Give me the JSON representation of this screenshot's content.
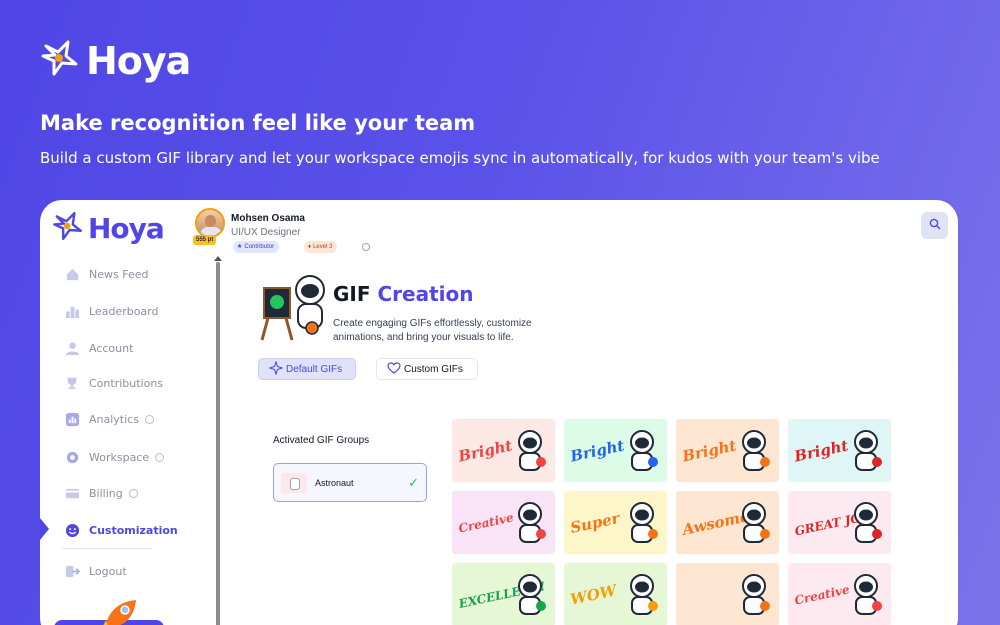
{
  "hero": {
    "brand": "Hoya",
    "title": "Make recognition feel like your team",
    "subtitle": "Build a custom GIF library and let your workspace emojis sync in automatically, for kudos with your team's vibe"
  },
  "app": {
    "brand": "Hoya",
    "sidebar": {
      "items": [
        {
          "label": "News Feed",
          "icon": "home-icon"
        },
        {
          "label": "Leaderboard",
          "icon": "leaderboard-icon"
        },
        {
          "label": "Account",
          "icon": "user-icon"
        },
        {
          "label": "Contributions",
          "icon": "trophy-icon"
        },
        {
          "label": "Analytics",
          "icon": "analytics-icon"
        },
        {
          "label": "Workspace",
          "icon": "gear-icon"
        },
        {
          "label": "Billing",
          "icon": "card-icon"
        },
        {
          "label": "Customization",
          "icon": "smile-icon"
        },
        {
          "label": "Logout",
          "icon": "logout-icon"
        }
      ]
    },
    "user": {
      "name": "Mohsen Osama",
      "role": "UI/UX Designer",
      "points": "555 pt",
      "badge_contributor": "Contributor",
      "badge_level": "Level 3"
    },
    "page": {
      "title_plain": "GIF",
      "title_accent": "Creation",
      "description": "Create engaging GIFs effortlessly, customize animations, and bring your visuals to life.",
      "tab_default": "Default GIFs",
      "tab_custom": "Custom GIFs",
      "groups_title": "Activated GIF Groups",
      "group_name": "Astronaut"
    },
    "gifs": [
      {
        "word": "Bright",
        "bg": "#fce8e4",
        "color": "#ef4444"
      },
      {
        "word": "Bright",
        "bg": "#dcfce7",
        "color": "#2563eb"
      },
      {
        "word": "Bright",
        "bg": "#fde7d3",
        "color": "#f97316"
      },
      {
        "word": "Bright",
        "bg": "#e0f5f5",
        "color": "#dc2626"
      },
      {
        "word": "Creative",
        "bg": "#f8e4f6",
        "color": "#ef4444"
      },
      {
        "word": "Super",
        "bg": "#fdf6c8",
        "color": "#f97316"
      },
      {
        "word": "Awsome",
        "bg": "#fde7d3",
        "color": "#f97316"
      },
      {
        "word": "GREAT JOB!",
        "bg": "#fdeaf0",
        "color": "#dc2626"
      },
      {
        "word": "EXCELLENT!",
        "bg": "#e6f7d6",
        "color": "#16a34a"
      },
      {
        "word": "WOW",
        "bg": "#e6f7d6",
        "color": "#f59e0b"
      },
      {
        "word": "",
        "bg": "#fde7d3",
        "color": "#f97316"
      },
      {
        "word": "Creative",
        "bg": "#fdeaf0",
        "color": "#ef4444"
      }
    ]
  }
}
